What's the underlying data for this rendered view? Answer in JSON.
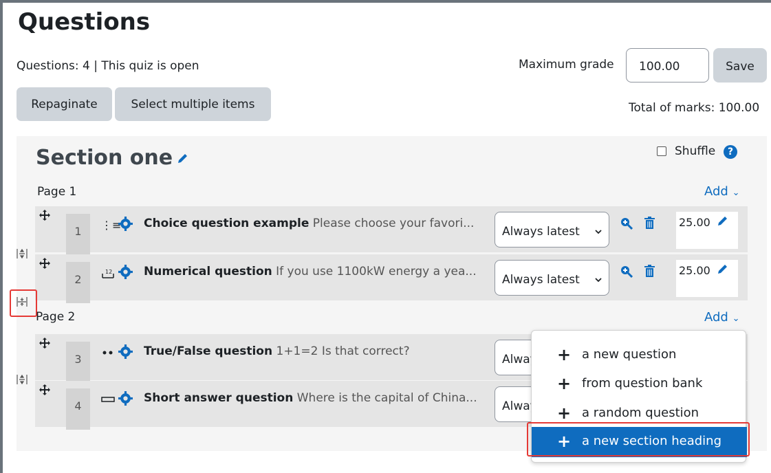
{
  "page": {
    "title": "Questions",
    "status": "Questions: 4 | This quiz is open",
    "max_grade_label": "Maximum grade",
    "max_grade_value": "100.00",
    "save_label": "Save",
    "repaginate_label": "Repaginate",
    "select_multiple_label": "Select multiple items",
    "total_marks": "Total of marks: 100.00"
  },
  "section": {
    "title": "Section one",
    "shuffle_label": "Shuffle",
    "help": "?",
    "pages": [
      {
        "label": "Page 1",
        "add": "Add"
      },
      {
        "label": "Page 2",
        "add": "Add"
      }
    ]
  },
  "questions": [
    {
      "num": "1",
      "name": "Choice question example",
      "text": " Please choose your favori...",
      "version": "Always latest",
      "mark": "25.00",
      "type_icon": "multichoice-icon"
    },
    {
      "num": "2",
      "name": "Numerical question",
      "text": " If you use 1100kW energy a yea...",
      "version": "Always latest",
      "mark": "25.00",
      "type_icon": "numerical-icon"
    },
    {
      "num": "3",
      "name": "True/False question",
      "text": " 1+1=2 Is that correct?",
      "version": "Alway",
      "mark": "",
      "type_icon": "truefalse-icon"
    },
    {
      "num": "4",
      "name": "Short answer question",
      "text": " Where is the capital of China...",
      "version": "Alway",
      "mark": "",
      "type_icon": "shortanswer-icon"
    }
  ],
  "add_menu": {
    "items": [
      "a new question",
      "from question bank",
      "a random question",
      "a new section heading"
    ],
    "plus": "+"
  },
  "colors": {
    "accent": "#0f6cbf",
    "highlight": "#e53935",
    "button_grey": "#ced4da"
  }
}
